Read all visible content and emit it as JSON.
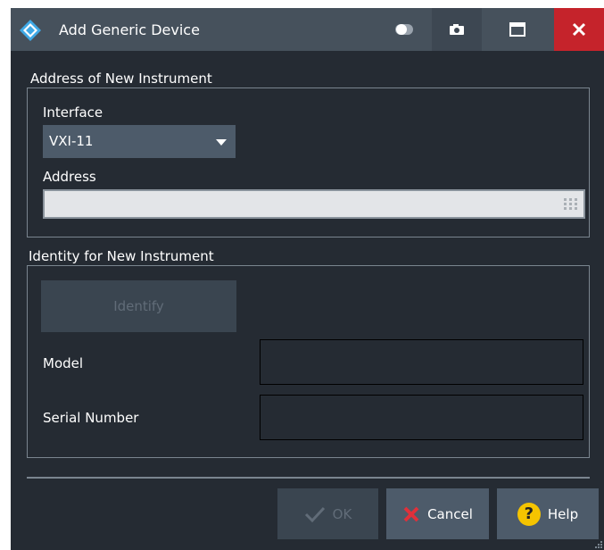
{
  "window": {
    "title": "Add Generic Device",
    "icons": [
      "app-logo-icon",
      "toggle-icon",
      "camera-icon",
      "maximize-icon",
      "close-icon"
    ],
    "accent_close": "#c5232b"
  },
  "address_group": {
    "title": "Address of New Instrument",
    "interface_label": "Interface",
    "interface_value": "VXI-11",
    "address_label": "Address",
    "address_value": ""
  },
  "identity_group": {
    "title": "Identity for New Instrument",
    "identify_label": "Identify",
    "model_label": "Model",
    "model_value": "",
    "serial_label": "Serial Number",
    "serial_value": ""
  },
  "buttons": {
    "ok_label": "OK",
    "cancel_label": "Cancel",
    "help_label": "Help",
    "help_glyph": "?"
  }
}
